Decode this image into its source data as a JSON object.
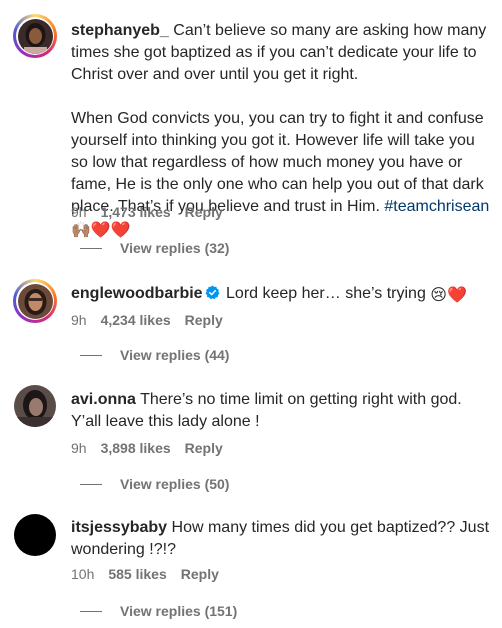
{
  "comments": [
    {
      "username": "stephanyeb_",
      "text_p1": " Can’t believe so many are asking how many times she got baptized as if you can’t dedicate your life to Christ over and over until you get it right.",
      "text_p2": "When God convicts you, you can try to fight it and confuse yourself into thinking you got it. However life will take you so low that regardless of how much money you have or fame, He is the only one who can help you out of that dark place. That’s if you believe and trust in Him. ",
      "hashtag": "#teamchrisean",
      "emojis": "🙌🏽❤️❤️",
      "time": "9h",
      "likes": "1,473 likes",
      "reply": "Reply",
      "view_replies": "View replies (32)",
      "avatar": "photo-avatar"
    },
    {
      "username": "englewoodbarbie",
      "verified": true,
      "text": " Lord keep her… she’s trying ",
      "emojis": "😢❤️",
      "time": "9h",
      "likes": "4,234 likes",
      "reply": "Reply",
      "view_replies": "View replies (44)",
      "avatar": "photo-avatar"
    },
    {
      "username": "avi.onna",
      "text": " There’s no time limit on getting right with god. Y’all leave this lady alone !",
      "time": "9h",
      "likes": "3,898 likes",
      "reply": "Reply",
      "view_replies": "View replies (50)",
      "avatar": "photo-avatar"
    },
    {
      "username": "itsjessybaby",
      "text": " How many times did you get baptized?? Just wondering !?!?",
      "time": "10h",
      "likes": "585 likes",
      "reply": "Reply",
      "view_replies": "View replies (151)",
      "avatar": "black-avatar"
    }
  ],
  "colors": {
    "text": "#262626",
    "secondary": "#737373",
    "hashtag": "#00376b",
    "verified": "#0095f6"
  }
}
